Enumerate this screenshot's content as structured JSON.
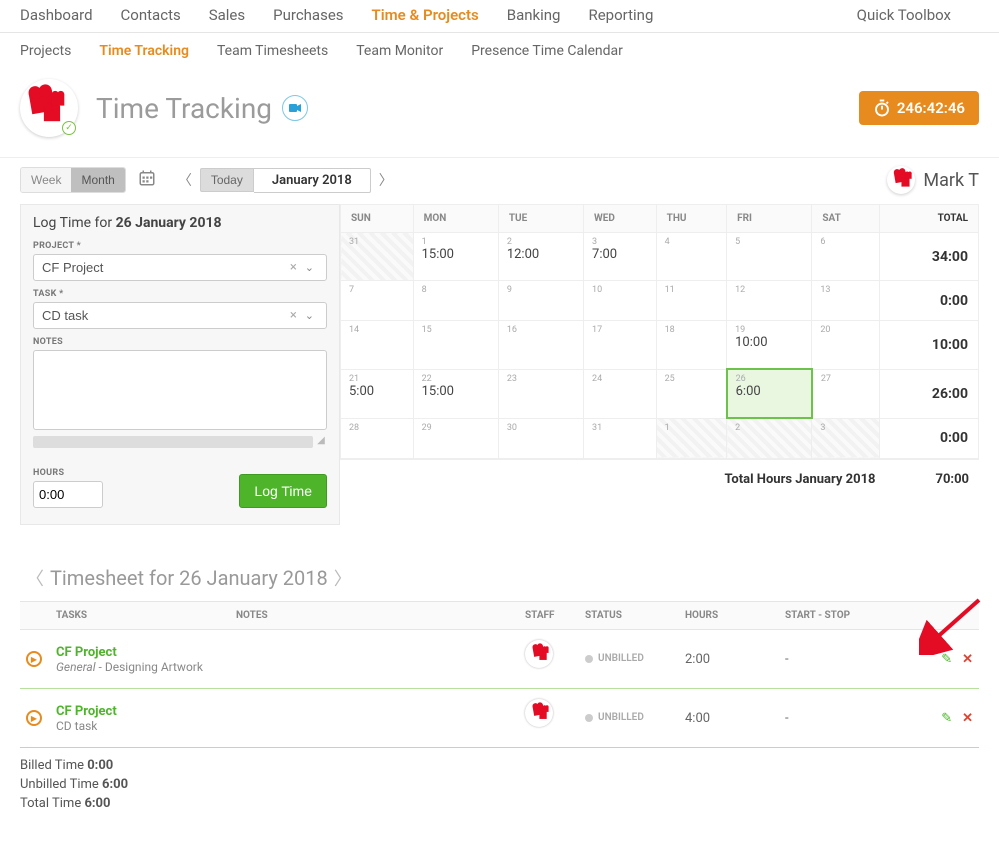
{
  "topnav": {
    "items": [
      "Dashboard",
      "Contacts",
      "Sales",
      "Purchases",
      "Time & Projects",
      "Banking",
      "Reporting"
    ],
    "active_index": 4,
    "right": "Quick Toolbox"
  },
  "subnav": {
    "items": [
      "Projects",
      "Time Tracking",
      "Team Timesheets",
      "Team Monitor",
      "Presence Time Calendar"
    ],
    "active_index": 1
  },
  "page": {
    "title": "Time Tracking",
    "timer": "246:42:46"
  },
  "controls": {
    "view_options": [
      "Week",
      "Month"
    ],
    "view_active": 1,
    "today_label": "Today",
    "period_label": "January 2018",
    "user_name": "Mark T"
  },
  "log_form": {
    "heading_prefix": "Log Time for ",
    "heading_date": "26 January 2018",
    "labels": {
      "project": "PROJECT *",
      "task": "TASK *",
      "notes": "NOTES",
      "hours": "HOURS"
    },
    "project_value": "CF Project",
    "task_value": "CD task",
    "hours_value": "0:00",
    "log_button": "Log Time"
  },
  "calendar": {
    "day_headers": [
      "SUN",
      "MON",
      "TUE",
      "WED",
      "THU",
      "FRI",
      "SAT",
      "TOTAL"
    ],
    "rows": [
      {
        "cells": [
          {
            "day": "31",
            "dimmed": true
          },
          {
            "day": "1",
            "hours": "15:00"
          },
          {
            "day": "2",
            "hours": "12:00"
          },
          {
            "day": "3",
            "hours": "7:00"
          },
          {
            "day": "4"
          },
          {
            "day": "5"
          },
          {
            "day": "6"
          }
        ],
        "total": "34:00"
      },
      {
        "cells": [
          {
            "day": "7"
          },
          {
            "day": "8"
          },
          {
            "day": "9"
          },
          {
            "day": "10"
          },
          {
            "day": "11"
          },
          {
            "day": "12"
          },
          {
            "day": "13"
          }
        ],
        "total": "0:00"
      },
      {
        "cells": [
          {
            "day": "14"
          },
          {
            "day": "15"
          },
          {
            "day": "16"
          },
          {
            "day": "17"
          },
          {
            "day": "18"
          },
          {
            "day": "19",
            "hours": "10:00"
          },
          {
            "day": "20"
          }
        ],
        "total": "10:00"
      },
      {
        "cells": [
          {
            "day": "21",
            "hours": "5:00"
          },
          {
            "day": "22",
            "hours": "15:00"
          },
          {
            "day": "23"
          },
          {
            "day": "24"
          },
          {
            "day": "25"
          },
          {
            "day": "26",
            "hours": "6:00",
            "selected": true
          },
          {
            "day": "27"
          }
        ],
        "total": "26:00"
      },
      {
        "cells": [
          {
            "day": "28"
          },
          {
            "day": "29"
          },
          {
            "day": "30"
          },
          {
            "day": "31"
          },
          {
            "day": "1",
            "dimmed": true
          },
          {
            "day": "2",
            "dimmed": true
          },
          {
            "day": "3",
            "dimmed": true
          }
        ],
        "total": "0:00"
      }
    ],
    "footer_label": "Total Hours January 2018",
    "footer_total": "70:00"
  },
  "timesheet": {
    "heading": "Timesheet for 26 January 2018",
    "columns": [
      "",
      "TASKS",
      "NOTES",
      "STAFF",
      "STATUS",
      "HOURS",
      "START - STOP",
      ""
    ],
    "rows": [
      {
        "project": "CF Project",
        "task_italic": "General",
        "task_rest": " - Designing Artwork",
        "status": "UNBILLED",
        "hours": "2:00",
        "startstop": "-"
      },
      {
        "project": "CF Project",
        "task_italic": "",
        "task_rest": "CD task",
        "status": "UNBILLED",
        "hours": "4:00",
        "startstop": "-"
      }
    ],
    "totals": {
      "billed_label": "Billed Time ",
      "billed_value": "0:00",
      "unbilled_label": "Unbilled Time ",
      "unbilled_value": "6:00",
      "total_label": "Total Time ",
      "total_value": "6:00"
    }
  }
}
